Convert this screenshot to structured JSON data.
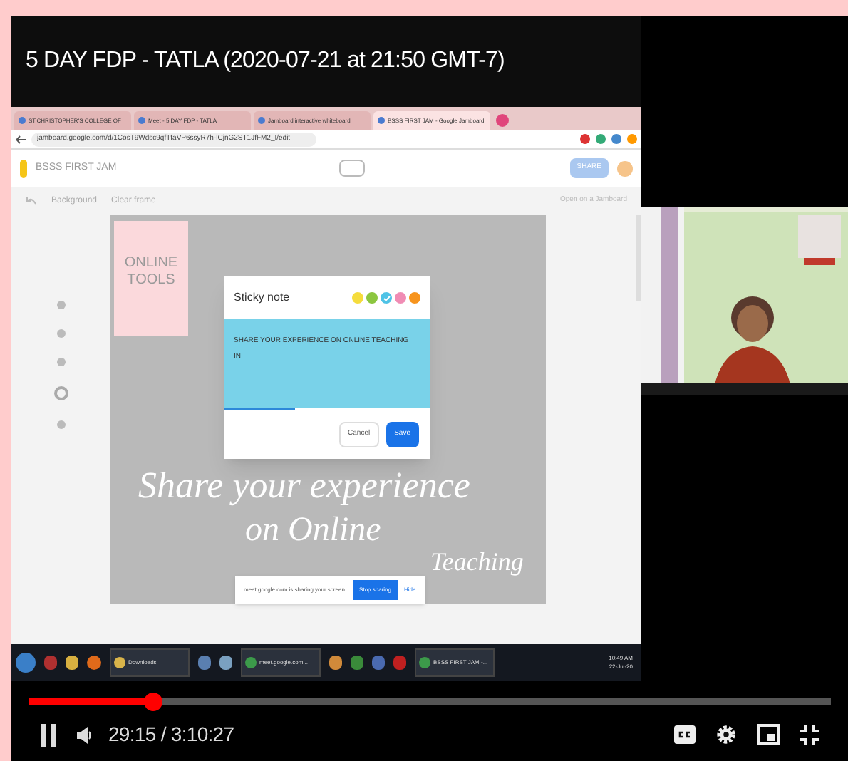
{
  "video_title": "5 DAY FDP - TATLA (2020-07-21 at 21:50 GMT-7)",
  "browser_tabs": [
    {
      "label": "ST.CHRISTOPHER'S COLLEGE OF",
      "selected": false
    },
    {
      "label": "Meet - 5 DAY FDP - TATLA",
      "selected": false
    },
    {
      "label": "Jamboard interactive whiteboard",
      "selected": false
    },
    {
      "label": "BSSS FIRST JAM - Google Jamboard",
      "selected": true
    }
  ],
  "address": "jamboard.google.com/d/1CosT9Wdsc9qfTfaVP6ssyR7h-lCjnG2ST1JfFM2_I/edit",
  "jamboard": {
    "title": "BSSS FIRST JAM",
    "toolbar": [
      "Background",
      "Clear frame"
    ],
    "share_label": "SHARE",
    "open_label": "Open on a Jamboard"
  },
  "canvas": {
    "note": "ONLINE TOOLS",
    "handwriting": [
      "Share your experience",
      "on Online",
      "Teaching"
    ]
  },
  "dialog": {
    "title": "Sticky note",
    "colors": [
      {
        "color": "#f5dc3c",
        "selected": false
      },
      {
        "color": "#8cc63f",
        "selected": false
      },
      {
        "color": "#4fc3e6",
        "selected": true
      },
      {
        "color": "#f08cb4",
        "selected": false
      },
      {
        "color": "#f7941d",
        "selected": false
      }
    ],
    "lines": [
      "SHARE YOUR EXPERIENCE ON ONLINE TEACHING",
      "IN"
    ],
    "buttons": [
      {
        "label": "Cancel",
        "kind": "secondary"
      },
      {
        "label": "Save",
        "kind": "primary"
      }
    ]
  },
  "share_bar": {
    "message": "meet.google.com is sharing your screen.",
    "stop": "Stop sharing",
    "hide": "Hide"
  },
  "taskbar": {
    "items": [
      {
        "label": "Downloads",
        "kind": "folder"
      },
      {
        "label": "meet.google.com...",
        "kind": "browser"
      },
      {
        "label": "BSSS FIRST JAM -...",
        "kind": "browser"
      }
    ],
    "time": "10:49 AM",
    "date": "22-Jul-20"
  },
  "player": {
    "progress": {
      "level": 0.154
    },
    "time": "29:15 / 3:10:27"
  }
}
